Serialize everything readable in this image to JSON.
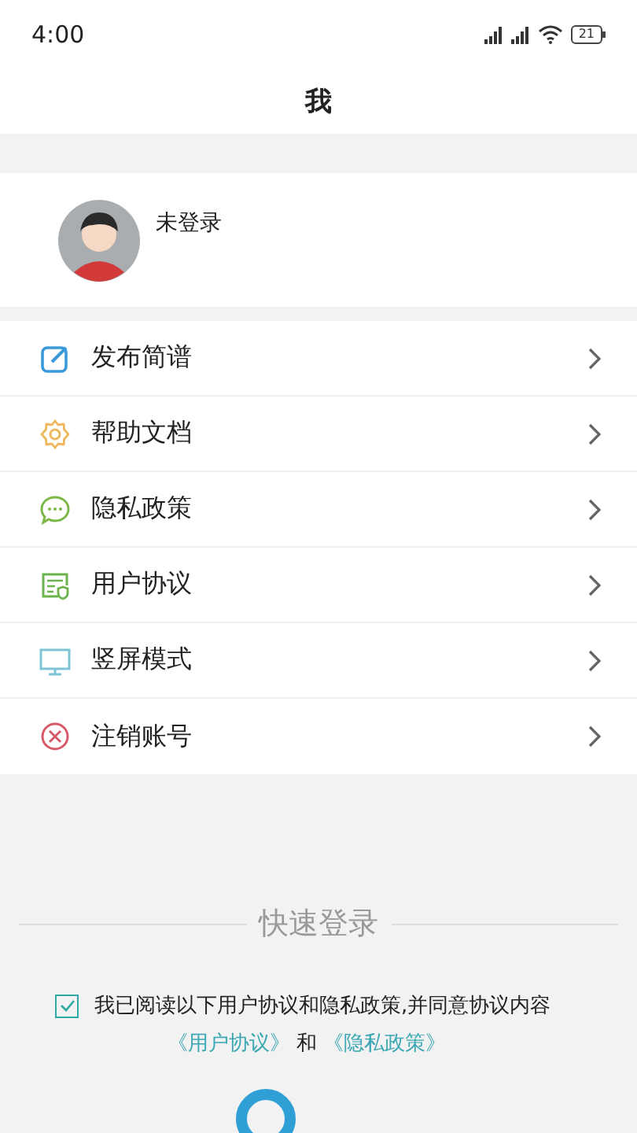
{
  "status_bar": {
    "time": "4:00",
    "battery": "21"
  },
  "header": {
    "title": "我"
  },
  "profile": {
    "name": "未登录"
  },
  "menu": [
    {
      "kind": "edit",
      "label": "发布简谱"
    },
    {
      "kind": "gear",
      "label": "帮助文档"
    },
    {
      "kind": "chat",
      "label": "隐私政策"
    },
    {
      "kind": "doc",
      "label": "用户协议"
    },
    {
      "kind": "monitor",
      "label": "竖屏模式"
    },
    {
      "kind": "cancel",
      "label": "注销账号"
    }
  ],
  "quick_login": {
    "title": "快速登录",
    "agreement": {
      "checked": true,
      "text": "我已阅读以下用户协议和隐私政策,并同意协议内容"
    },
    "links": [
      {
        "kind": "link",
        "text": "《用户协议》"
      },
      {
        "kind": "plain",
        "text": "和"
      },
      {
        "kind": "link",
        "text": "《隐私政策》"
      }
    ]
  }
}
